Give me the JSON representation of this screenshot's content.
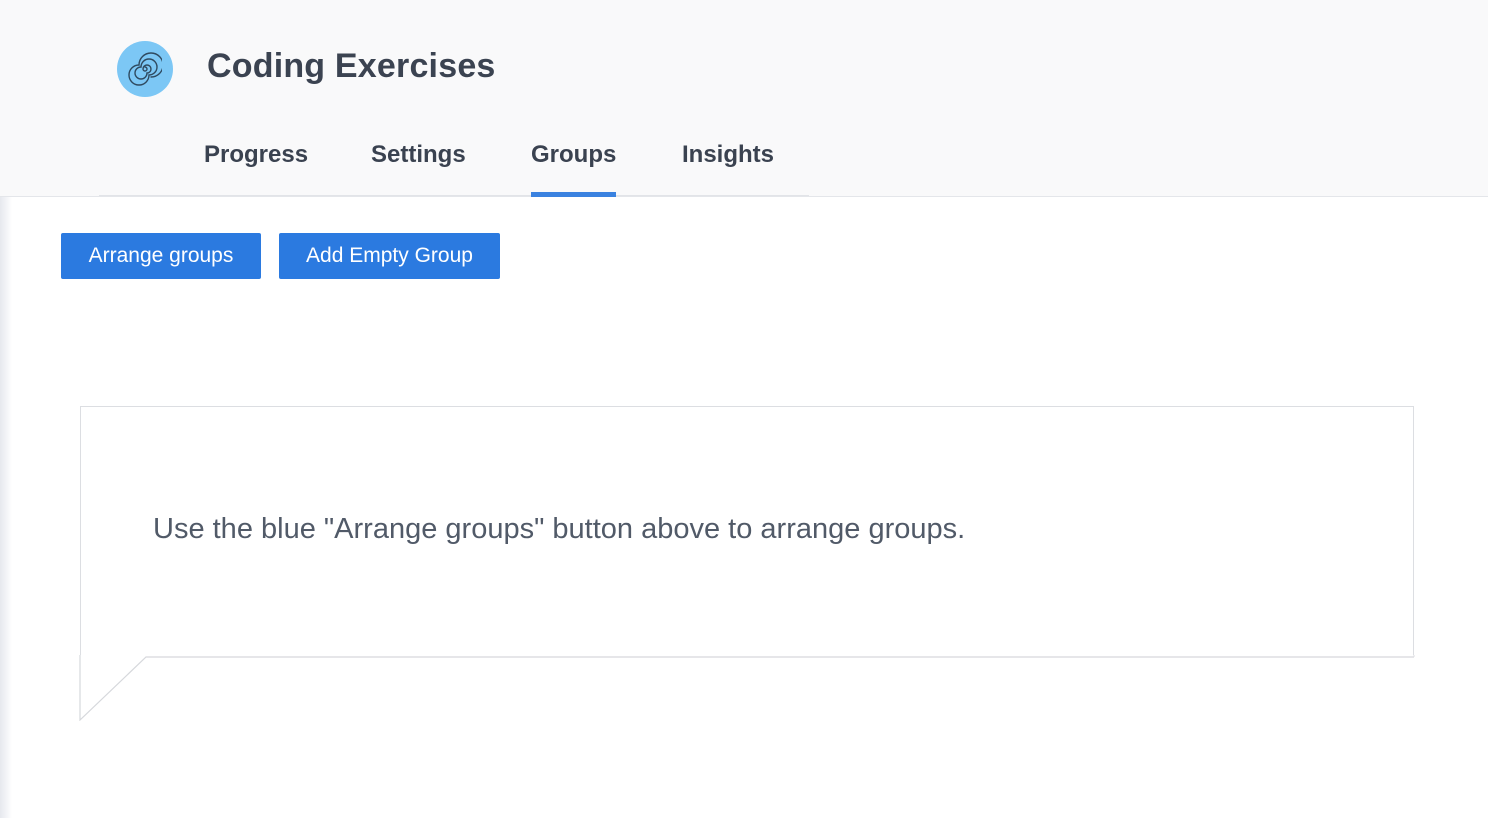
{
  "app": {
    "title": "Coding Exercises",
    "logo_icon": "spiral-icon",
    "accent_color": "#2b7ae0"
  },
  "tabs": [
    {
      "label": "Progress",
      "active": false
    },
    {
      "label": "Settings",
      "active": false
    },
    {
      "label": "Groups",
      "active": true
    },
    {
      "label": "Insights",
      "active": false
    }
  ],
  "toolbar": {
    "arrange_label": "Arrange groups",
    "add_group_label": "Add Empty Group"
  },
  "callout": {
    "message": "Use the blue \"Arrange groups\" button above to arrange groups."
  }
}
